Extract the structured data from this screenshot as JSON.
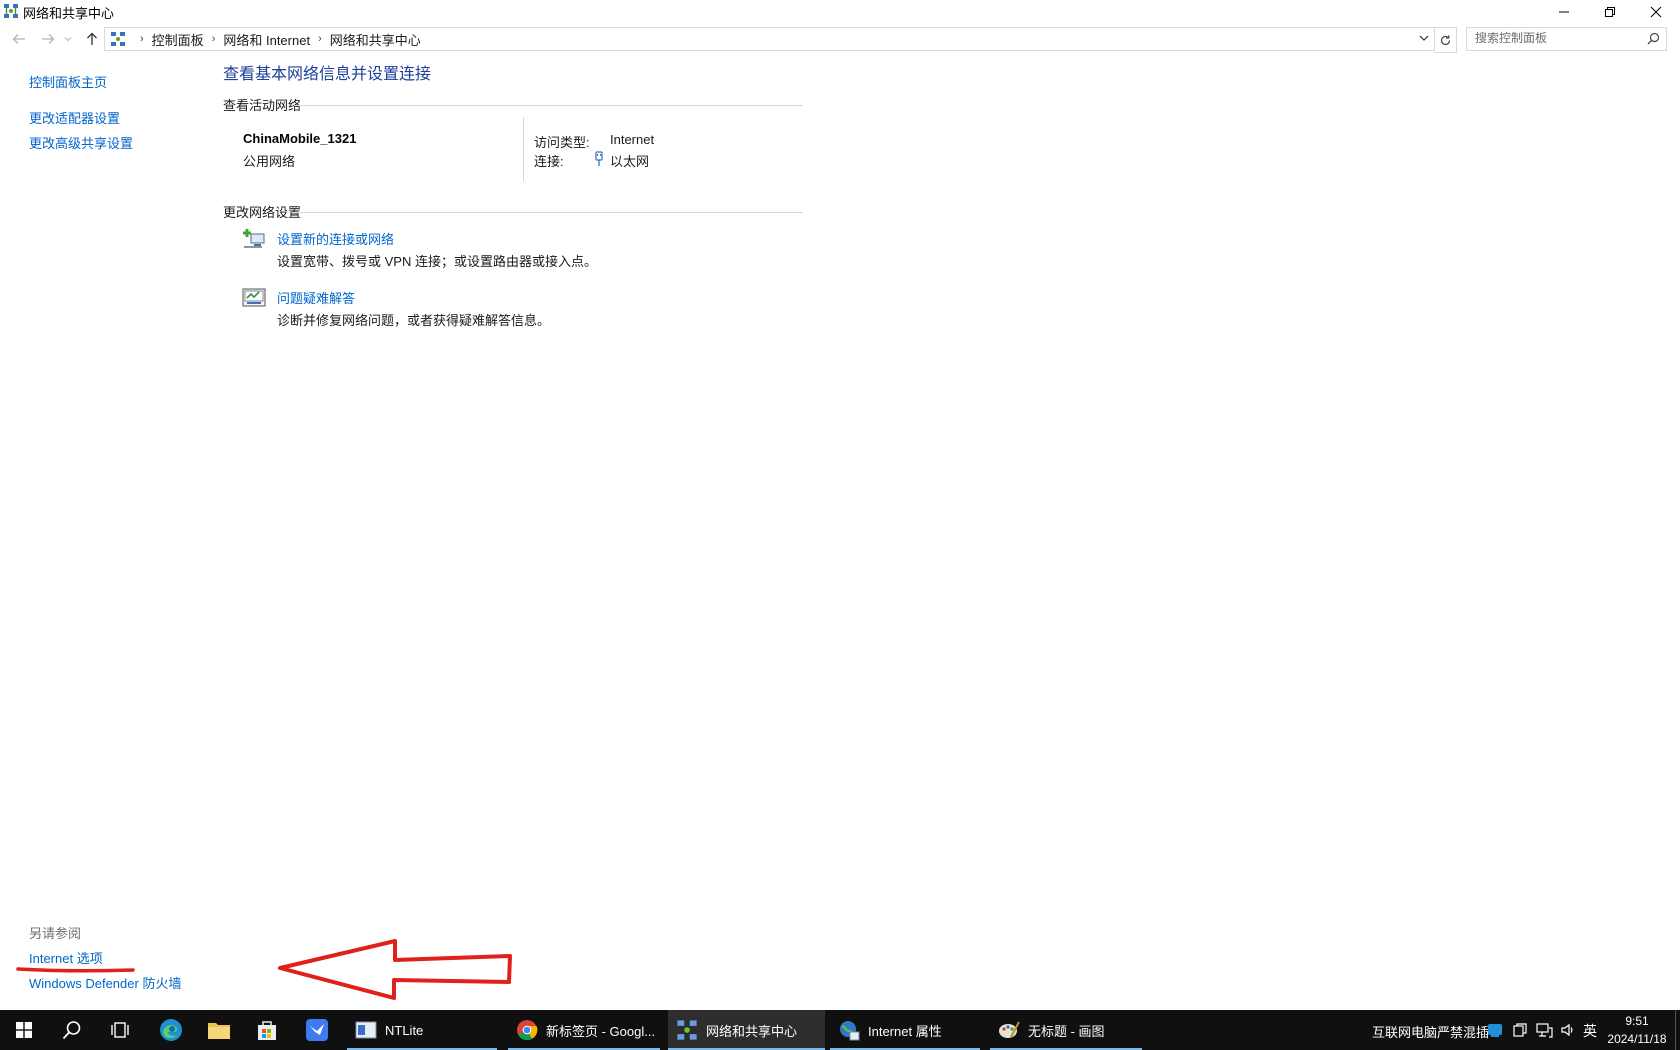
{
  "window": {
    "title": "网络和共享中心"
  },
  "address_bar": {
    "breadcrumbs": [
      "控制面板",
      "网络和 Internet",
      "网络和共享中心"
    ]
  },
  "search": {
    "placeholder": "搜索控制面板"
  },
  "left_pane": {
    "links": [
      "控制面板主页",
      "更改适配器设置",
      "更改高级共享设置"
    ],
    "see_also_label": "另请参阅",
    "see_also": [
      "Internet 选项",
      "Windows Defender 防火墙"
    ]
  },
  "main": {
    "heading": "查看基本网络信息并设置连接",
    "active_networks_label": "查看活动网络",
    "network": {
      "name": "ChinaMobile_1321",
      "type": "公用网络",
      "access_type_label": "访问类型:",
      "access_type_value": "Internet",
      "connection_label": "连接:",
      "connection_value": "以太网"
    },
    "change_settings_label": "更改网络设置",
    "tasks": [
      {
        "icon": "new-connection-icon",
        "title": "设置新的连接或网络",
        "desc": "设置宽带、拨号或 VPN 连接；或设置路由器或接入点。"
      },
      {
        "icon": "troubleshoot-icon",
        "title": "问题疑难解答",
        "desc": "诊断并修复网络问题，或者获得疑难解答信息。"
      }
    ]
  },
  "taskbar": {
    "apps": [
      {
        "label": "NTLite",
        "icon": "ntlite-icon"
      },
      {
        "label": "新标签页 - Googl...",
        "icon": "chrome-icon"
      },
      {
        "label": "网络和共享中心",
        "icon": "network-center-icon",
        "active": true
      },
      {
        "label": "Internet 属性",
        "icon": "internet-properties-icon"
      },
      {
        "label": "无标题 - 画图",
        "icon": "paint-icon"
      }
    ],
    "tray_text": "互联网电脑严禁混插",
    "ime": "英",
    "time": "9:51",
    "date": "2024/11/18"
  },
  "colors": {
    "link": "#0066cc",
    "heading": "#1e3f9a",
    "taskbar": "#101010",
    "annotation": "#e0201b"
  }
}
